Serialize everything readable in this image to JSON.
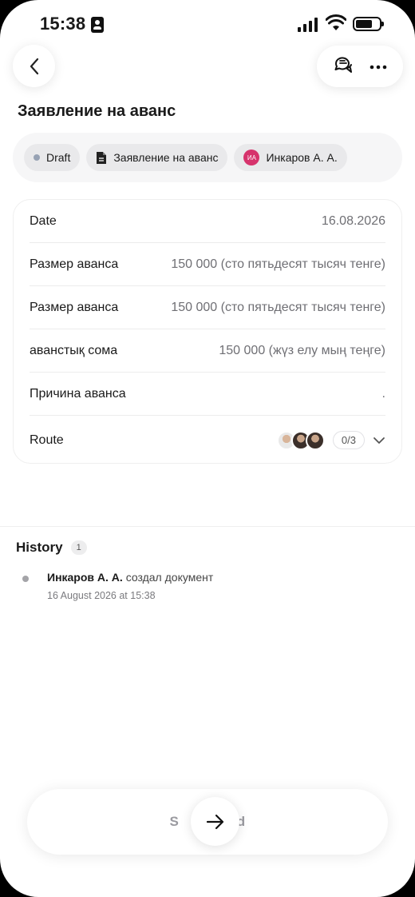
{
  "status_bar": {
    "time": "15:38"
  },
  "header": {
    "title": "Заявление на аванс"
  },
  "chips": [
    {
      "label": "Draft"
    },
    {
      "label": "Заявление на аванс"
    },
    {
      "label": "Инкаров А. А.",
      "initials": "ИА"
    }
  ],
  "details": [
    {
      "label": "Date",
      "value": "16.08.2026"
    },
    {
      "label": "Размер аванса",
      "value": "150 000 (сто пятьдесят тысяч тенге)"
    },
    {
      "label": "Размер аванса",
      "value": "150 000 (сто пятьдесят тысяч тенге)"
    },
    {
      "label": "аванстық сома",
      "value": "150 000 (жүз елу мың теңге)"
    },
    {
      "label": "Причина аванса",
      "value": "."
    }
  ],
  "route": {
    "label": "Route",
    "progress": "0/3"
  },
  "history": {
    "title": "History",
    "count": "1",
    "items": [
      {
        "name": "Инкаров А. А.",
        "action": "создал документ",
        "date": "16 August 2026 at 15:38"
      }
    ]
  },
  "footer": {
    "send_label_left": "S",
    "send_label_right": "nd"
  },
  "colors": {
    "draft_dot": "#97a2b4",
    "avatar": "#d6336c"
  }
}
